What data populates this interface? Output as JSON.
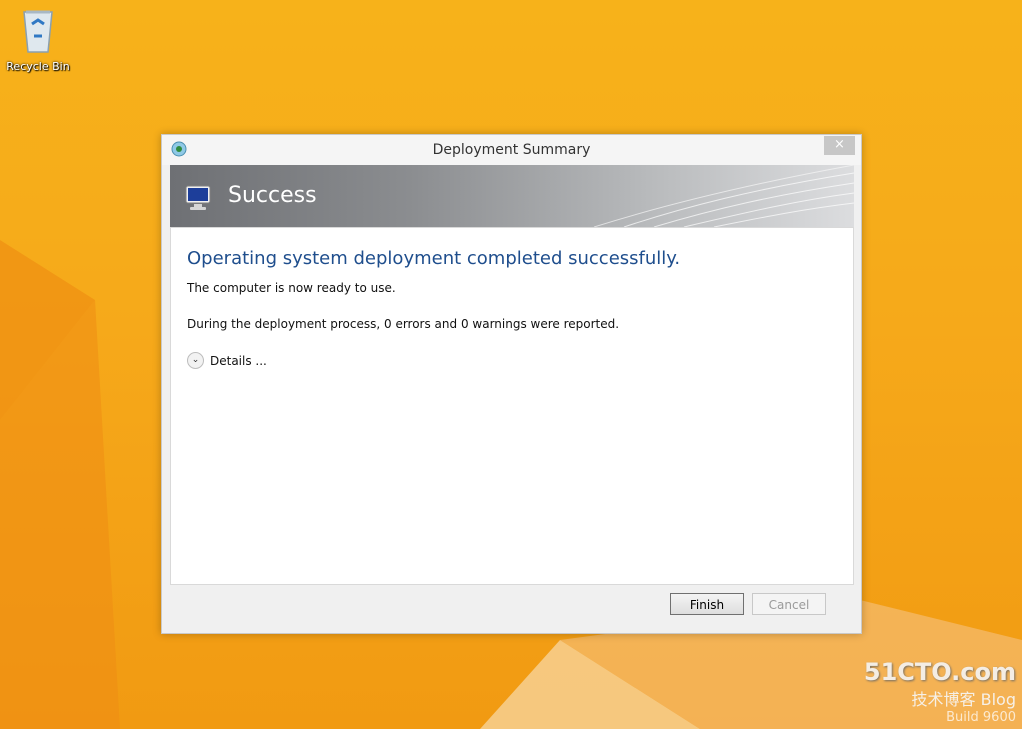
{
  "desktop": {
    "recycle_bin_label": "Recycle Bin"
  },
  "window": {
    "title": "Deployment Summary",
    "close_symbol": "×",
    "banner_title": "Success",
    "headline": "Operating system deployment completed successfully.",
    "message_ready": "The computer is now ready to use.",
    "message_report": "During the deployment process, 0 errors and 0 warnings were reported.",
    "details_label": "Details ...",
    "buttons": {
      "finish": "Finish",
      "cancel": "Cancel"
    }
  },
  "watermark": {
    "brand": "51CTO.com",
    "subtitle": "技术博客 Blog",
    "build": "Build 9600"
  },
  "colors": {
    "desktop_orange": "#f6a91a",
    "headline_blue": "#1f4e8d",
    "banner_gray": "#8b8d90"
  }
}
